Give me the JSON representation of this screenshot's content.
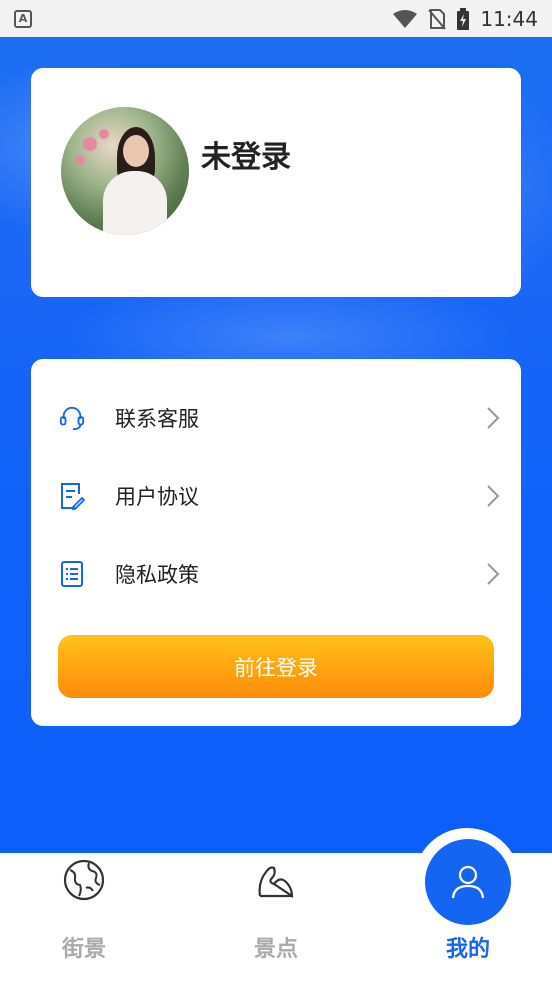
{
  "status_bar": {
    "left_badge": "A",
    "time": "11:44",
    "icons": [
      "wifi-icon",
      "no-sim-icon",
      "battery-charging-icon"
    ]
  },
  "profile": {
    "name": "未登录",
    "avatar_icon": "avatar-photo"
  },
  "menu": {
    "items": [
      {
        "label": "联系客服",
        "icon": "headset-icon"
      },
      {
        "label": "用户协议",
        "icon": "document-edit-icon"
      },
      {
        "label": "隐私政策",
        "icon": "list-document-icon"
      }
    ],
    "login_button": "前往登录"
  },
  "bottom_nav": {
    "items": [
      {
        "label": "街景",
        "icon": "globe-icon",
        "active": false
      },
      {
        "label": "景点",
        "icon": "mountain-icon",
        "active": false
      },
      {
        "label": "我的",
        "icon": "user-icon",
        "active": true
      }
    ]
  },
  "colors": {
    "primary": "#1565f3",
    "button_top": "#ffc21a",
    "button_bottom": "#ff8a0a",
    "inactive": "#aaaaaa"
  }
}
